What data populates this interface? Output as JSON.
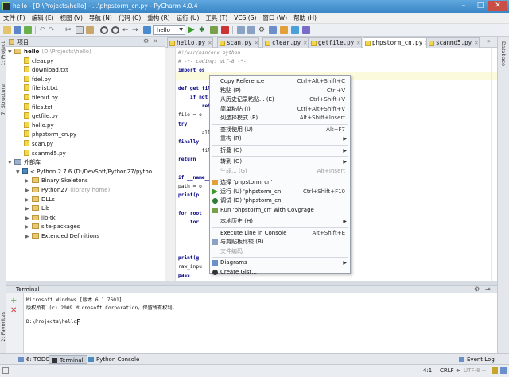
{
  "window": {
    "title": "hello - [D:\\Projects\\hello] - ...\\phpstorm_cn.py - PyCharm 4.0.4",
    "minimize": "–",
    "maximize": "□",
    "close": "✕"
  },
  "menubar": [
    "文件 (F)",
    "编辑 (E)",
    "视图 (V)",
    "导航 (N)",
    "代码 (C)",
    "重构 (R)",
    "运行 (U)",
    "工具 (T)",
    "VCS (S)",
    "窗口 (W)",
    "帮助 (H)"
  ],
  "toolbar": {
    "run_config": "hello"
  },
  "left_strip": {
    "project": "1: Project",
    "structure": "7: Structure",
    "favorites": "2: Favorites"
  },
  "right_strip": {
    "database": "Database"
  },
  "project": {
    "header": "项目",
    "root_name": "hello",
    "root_path": "(D:\\Projects\\hello)",
    "files": [
      "clear.py",
      "download.txt",
      "fdel.py",
      "filelist.txt",
      "fileout.py",
      "files.txt",
      "getfile.py",
      "hello.py",
      "phpstorm_cn.py",
      "scan.py",
      "scanmd5.py"
    ],
    "ext_libs": "外部库",
    "sdk": "< Python 2.7.6 (D:/DevSoft/Python27/pytho",
    "sdk_children": [
      {
        "name": "Binary Skeletons",
        "extra": ""
      },
      {
        "name": "Python27",
        "extra": "(library home)"
      },
      {
        "name": "DLLs",
        "extra": ""
      },
      {
        "name": "Lib",
        "extra": ""
      },
      {
        "name": "lib-tk",
        "extra": ""
      },
      {
        "name": "site-packages",
        "extra": ""
      },
      {
        "name": "Extended Definitions",
        "extra": ""
      }
    ]
  },
  "tabs": [
    {
      "label": "hello.py",
      "active": false
    },
    {
      "label": "scan.py",
      "active": false
    },
    {
      "label": "clear.py",
      "active": false
    },
    {
      "label": "getfile.py",
      "active": false
    },
    {
      "label": "phpstorm_cn.py",
      "active": true
    },
    {
      "label": "scanmd5.py",
      "active": false
    }
  ],
  "code": [
    {
      "text": "#!/usr/bin/env python",
      "cls": "cmt"
    },
    {
      "text": "# -*- coding: utf-8 -*-",
      "cls": "cmt"
    },
    {
      "text": "import os",
      "cls": "kw"
    },
    {
      "text": "",
      "cls": ""
    },
    {
      "text": "def get_fil",
      "cls": "kw"
    },
    {
      "text": "    if not",
      "cls": "kw"
    },
    {
      "text": "        retu",
      "cls": "kw"
    },
    {
      "text": "file = o",
      "cls": ""
    },
    {
      "text": "try",
      "cls": "kw"
    },
    {
      "text": "        all",
      "cls": ""
    },
    {
      "text": "finally",
      "cls": "kw"
    },
    {
      "text": "        fil",
      "cls": ""
    },
    {
      "text": "return",
      "cls": "kw"
    },
    {
      "text": "",
      "cls": ""
    },
    {
      "text": "if __name__",
      "cls": "kw"
    },
    {
      "text": "path = o",
      "cls": ""
    },
    {
      "text": "print(p",
      "cls": "kw"
    },
    {
      "text": "",
      "cls": ""
    },
    {
      "text": "for root",
      "cls": "kw"
    },
    {
      "text": "    for",
      "cls": "kw"
    },
    {
      "text": "",
      "cls": ""
    },
    {
      "text": "",
      "cls": ""
    },
    {
      "text": "",
      "cls": ""
    },
    {
      "text": "print(g",
      "cls": "kw"
    },
    {
      "text": "raw_inpu",
      "cls": ""
    },
    {
      "text": "pass",
      "cls": "kw"
    }
  ],
  "context_menu": [
    {
      "label": "Copy Reference",
      "shortcut": "Ctrl+Alt+Shift+C",
      "icon": "",
      "sub": false,
      "disabled": false,
      "sep": false
    },
    {
      "label": "粘贴 (P)",
      "shortcut": "Ctrl+V",
      "icon": "",
      "sub": false,
      "disabled": false,
      "sep": false
    },
    {
      "label": "从历史记录粘贴... (E)",
      "shortcut": "Ctrl+Shift+V",
      "icon": "",
      "sub": false,
      "disabled": false,
      "sep": false
    },
    {
      "label": "简单粘贴 (I)",
      "shortcut": "Ctrl+Alt+Shift+V",
      "icon": "",
      "sub": false,
      "disabled": false,
      "sep": false
    },
    {
      "label": "列选择模式 (E)",
      "shortcut": "Alt+Shift+Insert",
      "icon": "",
      "sub": false,
      "disabled": false,
      "sep": true
    },
    {
      "label": "查找使用 (U)",
      "shortcut": "Alt+F7",
      "icon": "",
      "sub": false,
      "disabled": false,
      "sep": false
    },
    {
      "label": "重构 (R)",
      "shortcut": "",
      "icon": "",
      "sub": true,
      "disabled": false,
      "sep": true
    },
    {
      "label": "折叠 (G)",
      "shortcut": "",
      "icon": "",
      "sub": true,
      "disabled": false,
      "sep": true
    },
    {
      "label": "转到 (G)",
      "shortcut": "",
      "icon": "",
      "sub": true,
      "disabled": false,
      "sep": false
    },
    {
      "label": "生成... (G)",
      "shortcut": "Alt+Insert",
      "icon": "",
      "sub": false,
      "disabled": true,
      "sep": true
    },
    {
      "label": "选择 'phpstorm_cn'",
      "shortcut": "",
      "icon": "select-icon",
      "sub": false,
      "disabled": false,
      "sep": false
    },
    {
      "label": "运行 (U) 'phpstorm_cn'",
      "shortcut": "Ctrl+Shift+F10",
      "icon": "run-icon",
      "sub": false,
      "disabled": false,
      "sep": false
    },
    {
      "label": "调试 (D) 'phpstorm_cn'",
      "shortcut": "",
      "icon": "debug-icon",
      "sub": false,
      "disabled": false,
      "sep": false
    },
    {
      "label": "Run 'phpstorm_cn' with Covgrage",
      "shortcut": "",
      "icon": "coverage-icon",
      "sub": false,
      "disabled": false,
      "sep": true
    },
    {
      "label": "本地历史 (H)",
      "shortcut": "",
      "icon": "",
      "sub": true,
      "disabled": false,
      "sep": true
    },
    {
      "label": "Execute Line in Console",
      "shortcut": "Alt+Shift+E",
      "icon": "",
      "sub": false,
      "disabled": false,
      "sep": false
    },
    {
      "label": "与剪贴板比较 (B)",
      "shortcut": "",
      "icon": "compare-icon",
      "sub": false,
      "disabled": false,
      "sep": false
    },
    {
      "label": "文件编码",
      "shortcut": "",
      "icon": "",
      "sub": false,
      "disabled": true,
      "sep": true
    },
    {
      "label": "Diagrams",
      "shortcut": "",
      "icon": "diagram-icon",
      "sub": true,
      "disabled": false,
      "sep": false
    },
    {
      "label": "Create Gist...",
      "shortcut": "",
      "icon": "github-icon",
      "sub": false,
      "disabled": false,
      "sep": false
    }
  ],
  "terminal": {
    "title": "Terminal",
    "lines": [
      "Microsoft Windows [版本 6.1.7601]",
      "版权所有 (c) 2009 Microsoft Corporation。保留所有权利。",
      "",
      "D:\\Projects\\hello>"
    ]
  },
  "bottom_tabs": [
    {
      "label": "6: TODO",
      "active": false
    },
    {
      "label": "Terminal",
      "active": true
    },
    {
      "label": "Python Console",
      "active": false
    }
  ],
  "event_log": "Event Log",
  "status": {
    "position": "4:1",
    "line_sep": "CRLF ÷",
    "encoding": "UTF-8 ÷"
  },
  "colors": {
    "accent": "#3a86c6",
    "run_green": "#3c9a2a",
    "debug_green": "#2f7d32",
    "folder": "#e8c870"
  }
}
